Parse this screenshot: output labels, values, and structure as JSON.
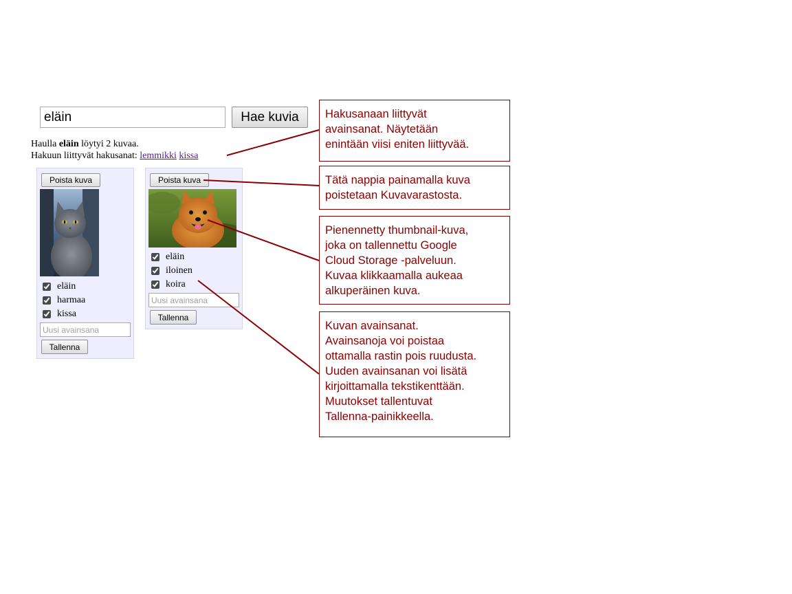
{
  "search": {
    "query": "eläin",
    "button_label": "Hae kuvia"
  },
  "results": {
    "prefix": "Haulla ",
    "term": "eläin",
    "suffix": " löytyi 2 kuvaa.",
    "related_prefix": "Hakuun liittyvät hakusanat: ",
    "related": [
      "lemmikki",
      "kissa"
    ]
  },
  "cards": [
    {
      "delete_label": "Poista kuva",
      "image": "cat-thumbnail",
      "keywords": [
        "eläin",
        "harmaa",
        "kissa"
      ],
      "new_keyword_placeholder": "Uusi avainsana",
      "save_label": "Tallenna"
    },
    {
      "delete_label": "Poista kuva",
      "image": "dog-thumbnail",
      "keywords": [
        "eläin",
        "iloinen",
        "koira"
      ],
      "new_keyword_placeholder": "Uusi avainsana",
      "save_label": "Tallenna"
    }
  ],
  "callouts": [
    "Hakusanaan liittyvät\navainsanat. Näytetään\nenintään viisi eniten liittyvää.",
    "Tätä nappia painamalla kuva\npoistetaan Kuvavarastosta.",
    "Pienennetty thumbnail-kuva,\njoka on tallennettu Google\nCloud Storage -palveluun.\nKuvaa klikkaamalla aukeaa\nalkuperäinen kuva.",
    "Kuvan avainsanat.\nAvainsanoja voi poistaa\nottamalla rastin pois ruudusta.\nUuden avainsanan voi lisätä\nkirjoittamalla tekstikenttään.\nMuutokset tallentuvat\nTallenna-painikkeella."
  ],
  "colors": {
    "callout": "#8b0000",
    "card_bg": "#eeeeff",
    "link": "#551a8b"
  }
}
